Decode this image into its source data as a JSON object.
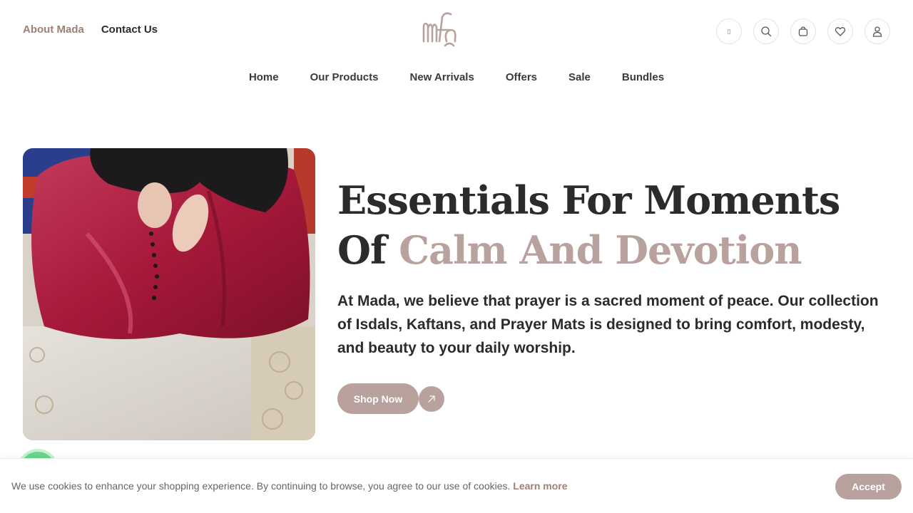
{
  "header": {
    "links": [
      {
        "label": "About Mada"
      },
      {
        "label": "Contact Us"
      }
    ],
    "icons": [
      "flag-icon",
      "search-icon",
      "cart-icon",
      "heart-icon",
      "user-icon"
    ]
  },
  "nav": {
    "items": [
      {
        "label": "Home"
      },
      {
        "label": "Our Products"
      },
      {
        "label": "New Arrivals"
      },
      {
        "label": "Offers"
      },
      {
        "label": "Sale"
      },
      {
        "label": "Bundles"
      }
    ]
  },
  "hero": {
    "title_main": "Essentials For Moments Of ",
    "title_accent": "Calm And Devotion",
    "description": "At Mada, we believe that prayer is a sacred moment of peace. Our collection of Isdals, Kaftans, and Prayer Mats is designed to bring comfort, modesty, and beauty to your daily worship.",
    "cta_label": "Shop Now"
  },
  "cookie": {
    "text": "We use cookies to enhance your shopping experience. By continuing to browse, you agree to our use of cookies.",
    "learn_more": "Learn more",
    "accept_label": "Accept"
  },
  "colors": {
    "accent": "#b9a29e",
    "accent_text": "#9d7f76",
    "dark": "#2b2b2b"
  }
}
